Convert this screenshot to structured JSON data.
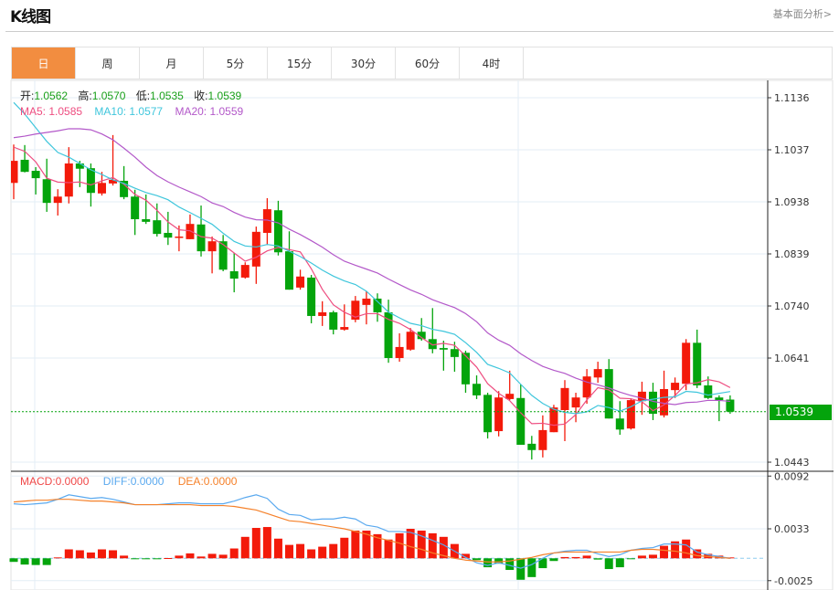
{
  "header": {
    "title": "K线图",
    "link": "基本面分析>"
  },
  "tabs": [
    "日",
    "周",
    "月",
    "5分",
    "15分",
    "30分",
    "60分",
    "4时"
  ],
  "active_tab": 0,
  "info": {
    "open_label": "开:",
    "open": "1.0562",
    "high_label": "高:",
    "high": "1.0570",
    "low_label": "低:",
    "low": "1.0535",
    "close_label": "收:",
    "close": "1.0539"
  },
  "ma_legend": {
    "ma5": "MA5: 1.0585",
    "ma10": "MA10: 1.0577",
    "ma20": "MA20: 1.0559"
  },
  "macd_legend": {
    "macd": "MACD:0.0000",
    "diff": "DIFF:0.0000",
    "dea": "DEA:0.0000"
  },
  "current_price": "1.0539",
  "colors": {
    "up": "#f31a0a",
    "down": "#04a40c",
    "ma5": "#ee4d80",
    "ma10": "#3fc6dc",
    "ma20": "#b358c9",
    "diff": "#5aa9ef",
    "dea": "#f5812a",
    "macd_label": "#f04848",
    "active_tab": "#f28d40"
  },
  "chart_data": {
    "type": "candlestick",
    "price_axis_ticks": [
      "1.1136",
      "1.1037",
      "1.0938",
      "1.0839",
      "1.0740",
      "1.0641",
      "1.0443"
    ],
    "price_range": [
      1.0443,
      1.1136
    ],
    "macd_axis_ticks": [
      "0.0092",
      "0.0033",
      "-0.0025"
    ],
    "candles_ohlc": [
      [
        1.0974,
        1.1047,
        1.0943,
        1.1016
      ],
      [
        1.1018,
        1.1046,
        1.0994,
        1.0995
      ],
      [
        1.0997,
        1.1004,
        1.0952,
        1.0983
      ],
      [
        1.0981,
        1.102,
        1.0919,
        1.0936
      ],
      [
        1.0936,
        1.0962,
        1.0912,
        1.0948
      ],
      [
        1.0948,
        1.1042,
        1.0935,
        1.1011
      ],
      [
        1.1011,
        1.1016,
        1.0966,
        1.1001
      ],
      [
        1.1002,
        1.1011,
        1.0929,
        1.0955
      ],
      [
        1.0954,
        1.0995,
        1.095,
        1.0974
      ],
      [
        1.0973,
        1.1065,
        1.0969,
        1.098
      ],
      [
        1.0978,
        1.1006,
        1.0943,
        1.0947
      ],
      [
        1.0948,
        1.0961,
        1.0875,
        1.0905
      ],
      [
        1.0905,
        1.0952,
        1.0896,
        1.09
      ],
      [
        1.0903,
        1.0935,
        1.0872,
        1.0877
      ],
      [
        1.0879,
        1.0919,
        1.0856,
        1.087
      ],
      [
        1.087,
        1.0893,
        1.0844,
        1.0872
      ],
      [
        1.0867,
        1.0914,
        1.0867,
        1.0896
      ],
      [
        1.0895,
        1.0931,
        1.0834,
        1.0844
      ],
      [
        1.0844,
        1.0872,
        1.0802,
        1.0863
      ],
      [
        1.0863,
        1.0875,
        1.0806,
        1.0809
      ],
      [
        1.0806,
        1.0841,
        1.0766,
        1.0792
      ],
      [
        1.0794,
        1.0823,
        1.0792,
        1.0818
      ],
      [
        1.0815,
        1.0891,
        1.0782,
        1.0881
      ],
      [
        1.0879,
        1.0945,
        1.0856,
        1.0924
      ],
      [
        1.0922,
        1.094,
        1.0836,
        1.0842
      ],
      [
        1.0844,
        1.0882,
        1.0771,
        1.0771
      ],
      [
        1.0775,
        1.0809,
        1.0771,
        1.0796
      ],
      [
        1.0794,
        1.0799,
        1.0707,
        1.0721
      ],
      [
        1.0721,
        1.0749,
        1.0702,
        1.0728
      ],
      [
        1.0728,
        1.0731,
        1.0686,
        1.0695
      ],
      [
        1.0695,
        1.0743,
        1.0693,
        1.07
      ],
      [
        1.0714,
        1.0759,
        1.0709,
        1.075
      ],
      [
        1.0742,
        1.0768,
        1.0705,
        1.0754
      ],
      [
        1.0754,
        1.0764,
        1.071,
        1.0728
      ],
      [
        1.0728,
        1.0752,
        1.0632,
        1.0641
      ],
      [
        1.0641,
        1.0688,
        1.0634,
        1.0662
      ],
      [
        1.0657,
        1.0698,
        1.0655,
        1.0691
      ],
      [
        1.0691,
        1.0717,
        1.0674,
        1.0677
      ],
      [
        1.0677,
        1.0736,
        1.065,
        1.0658
      ],
      [
        1.066,
        1.0674,
        1.0617,
        1.0657
      ],
      [
        1.0658,
        1.0672,
        1.0615,
        1.0643
      ],
      [
        1.0651,
        1.0655,
        1.0575,
        1.0591
      ],
      [
        1.0592,
        1.0608,
        1.0563,
        1.057
      ],
      [
        1.0571,
        1.0575,
        1.0488,
        1.05
      ],
      [
        1.0502,
        1.0578,
        1.0492,
        1.0566
      ],
      [
        1.0563,
        1.0617,
        1.0561,
        1.0573
      ],
      [
        1.0565,
        1.0591,
        1.0476,
        1.0476
      ],
      [
        1.0478,
        1.0493,
        1.0448,
        1.0466
      ],
      [
        1.0466,
        1.0532,
        1.0452,
        1.0504
      ],
      [
        1.05,
        1.0552,
        1.05,
        1.0547
      ],
      [
        1.0542,
        1.0599,
        1.0483,
        1.0584
      ],
      [
        1.0547,
        1.0575,
        1.0519,
        1.0566
      ],
      [
        1.0566,
        1.062,
        1.0554,
        1.0606
      ],
      [
        1.0604,
        1.0634,
        1.0594,
        1.062
      ],
      [
        1.062,
        1.0639,
        1.0526,
        1.0526
      ],
      [
        1.0526,
        1.0559,
        1.0495,
        1.0505
      ],
      [
        1.0507,
        1.0563,
        1.0505,
        1.0561
      ],
      [
        1.0559,
        1.0596,
        1.0533,
        1.0577
      ],
      [
        1.0577,
        1.0594,
        1.0523,
        1.0535
      ],
      [
        1.0532,
        1.0617,
        1.0528,
        1.0582
      ],
      [
        1.058,
        1.0604,
        1.0565,
        1.0594
      ],
      [
        1.0592,
        1.0677,
        1.058,
        1.067
      ],
      [
        1.067,
        1.0695,
        1.0584,
        1.0589
      ],
      [
        1.0589,
        1.0606,
        1.0563,
        1.0565
      ],
      [
        1.0566,
        1.057,
        1.0521,
        1.0561
      ],
      [
        1.0562,
        1.057,
        1.0535,
        1.0539
      ]
    ],
    "ma_seed": {
      "ma5": [
        1.1042,
        1.1034,
        1.1014,
        1.0983
      ],
      "ma10": [
        1.1127,
        1.1105,
        1.1079,
        1.1053,
        1.1032,
        1.1023,
        1.1011,
        1.0999,
        1.099
      ],
      "ma20": [
        1.106,
        1.1063,
        1.1067,
        1.107,
        1.1073,
        1.1077,
        1.1077,
        1.1075,
        1.1067,
        1.1056,
        1.104,
        1.1023,
        1.1004,
        1.0988,
        1.0976,
        1.0966,
        1.0957,
        1.0948,
        1.0936
      ]
    },
    "macd_hist": [
      -0.0004,
      -0.0007,
      -0.00075,
      -0.00075,
      0.0001,
      0.001,
      0.0009,
      0.00065,
      0.001,
      0.0009,
      0.0003,
      -0.0001,
      -0.0001,
      -0.0001,
      3e-05,
      0.0003,
      0.00055,
      0.0002,
      0.0005,
      0.0004,
      0.0011,
      0.0024,
      0.0034,
      0.0035,
      0.0022,
      0.0015,
      0.0016,
      0.001,
      0.0013,
      0.0016,
      0.0023,
      0.0031,
      0.0031,
      0.0027,
      0.0021,
      0.0028,
      0.0033,
      0.0031,
      0.0028,
      0.0024,
      0.0016,
      0.0005,
      -0.0002,
      -0.001,
      -0.0006,
      -0.0013,
      -0.0024,
      -0.0021,
      -0.0011,
      -0.0003,
      0.00014,
      0.00014,
      0.0003,
      -0.00014,
      -0.0012,
      -0.001,
      -3e-05,
      0.0003,
      0.0004,
      0.0014,
      0.0019,
      0.0021,
      0.001,
      0.0005,
      0.0003,
      0.0001
    ],
    "diff": [
      0.0061,
      0.006,
      0.0061,
      0.0062,
      0.0066,
      0.0071,
      0.0069,
      0.0067,
      0.0068,
      0.0066,
      0.0063,
      0.006,
      0.006,
      0.006,
      0.0061,
      0.0062,
      0.0062,
      0.0061,
      0.0061,
      0.0061,
      0.0064,
      0.0068,
      0.0071,
      0.0067,
      0.0055,
      0.0049,
      0.0048,
      0.0043,
      0.0044,
      0.0044,
      0.0046,
      0.0044,
      0.0037,
      0.0035,
      0.003,
      0.003,
      0.0029,
      0.0025,
      0.002,
      0.0015,
      0.0008,
      0.0001,
      -0.0005,
      -0.0008,
      -0.0005,
      -0.0008,
      -0.0011,
      -0.0007,
      0.0,
      0.0006,
      0.0008,
      0.0009,
      0.0009,
      0.0005,
      0.0002,
      0.0004,
      0.0009,
      0.0011,
      0.0012,
      0.0016,
      0.0016,
      0.0015,
      0.0007,
      0.0004,
      0.0002,
      0.0
    ],
    "dea": [
      0.0063,
      0.0064,
      0.0065,
      0.0065,
      0.0066,
      0.0066,
      0.0065,
      0.0064,
      0.0064,
      0.0063,
      0.0062,
      0.006,
      0.006,
      0.006,
      0.006,
      0.006,
      0.006,
      0.0059,
      0.0059,
      0.0059,
      0.0058,
      0.0056,
      0.0054,
      0.005,
      0.0046,
      0.0042,
      0.0041,
      0.0039,
      0.0037,
      0.0035,
      0.0033,
      0.003,
      0.0027,
      0.0023,
      0.002,
      0.0017,
      0.0013,
      0.001,
      0.0006,
      0.0003,
      0.0,
      -0.0002,
      -0.0003,
      -0.0004,
      -0.0004,
      -0.0003,
      -0.0001,
      0.0001,
      0.0004,
      0.0006,
      0.0007,
      0.0007,
      0.0007,
      0.0007,
      0.0007,
      0.0007,
      0.0009,
      0.001,
      0.001,
      0.0009,
      0.0008,
      0.0006,
      0.0003,
      0.0002,
      0.0001,
      0.0
    ]
  }
}
